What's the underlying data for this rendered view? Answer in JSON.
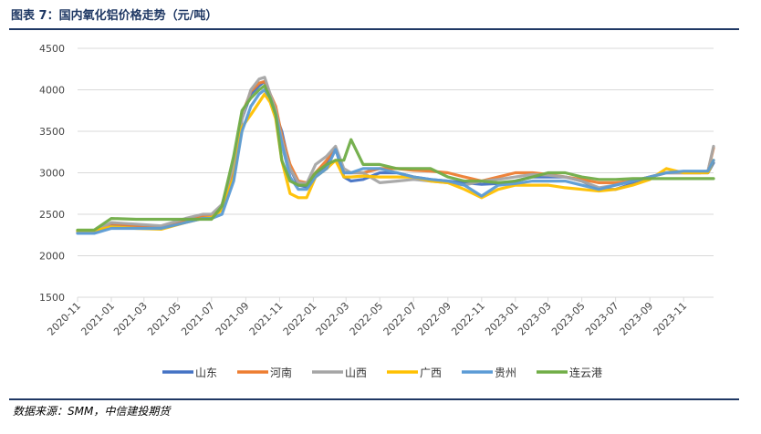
{
  "caption": "图表 7：国内氧化铝价格走势（元/吨）",
  "source": "数据来源：SMM，中信建投期货",
  "chart_data": {
    "type": "line",
    "title": "",
    "xlabel": "",
    "ylabel": "",
    "ylim": [
      1500,
      4500
    ],
    "yticks": [
      1500,
      2000,
      2500,
      3000,
      3500,
      4000,
      4500
    ],
    "xticks": [
      "2020-11",
      "2021-01",
      "2021-03",
      "2021-05",
      "2021-07",
      "2021-09",
      "2021-11",
      "2022-01",
      "2022-03",
      "2022-05",
      "2022-07",
      "2022-09",
      "2022-11",
      "2023-01",
      "2023-03",
      "2023-05",
      "2023-07",
      "2023-09",
      "2023-11"
    ],
    "xlim": [
      "2020-11-01",
      "2023-12-25"
    ],
    "grid": "horizontal",
    "legend_position": "bottom",
    "series": [
      {
        "name": "山东",
        "color": "#4472c4",
        "x": [
          "2020-11-01",
          "2020-12-01",
          "2021-01-01",
          "2021-02-15",
          "2021-04-01",
          "2021-05-15",
          "2021-06-15",
          "2021-07-01",
          "2021-07-20",
          "2021-08-10",
          "2021-08-25",
          "2021-09-10",
          "2021-09-25",
          "2021-10-05",
          "2021-10-15",
          "2021-10-25",
          "2021-11-05",
          "2021-11-20",
          "2021-12-05",
          "2021-12-20",
          "2022-01-05",
          "2022-01-25",
          "2022-02-10",
          "2022-02-25",
          "2022-03-10",
          "2022-04-01",
          "2022-05-01",
          "2022-06-01",
          "2022-07-01",
          "2022-08-01",
          "2022-09-01",
          "2022-10-01",
          "2022-11-01",
          "2022-12-01",
          "2023-01-01",
          "2023-02-01",
          "2023-03-01",
          "2023-04-01",
          "2023-05-01",
          "2023-06-01",
          "2023-07-01",
          "2023-08-01",
          "2023-09-01",
          "2023-10-01",
          "2023-11-01",
          "2023-12-01",
          "2023-12-15",
          "2023-12-25"
        ],
        "y": [
          2280,
          2280,
          2380,
          2360,
          2340,
          2420,
          2460,
          2470,
          2560,
          2980,
          3650,
          3950,
          4050,
          4100,
          3900,
          3700,
          3500,
          3050,
          2850,
          2830,
          2950,
          3100,
          3300,
          2950,
          2900,
          2920,
          3000,
          3000,
          2950,
          2920,
          2900,
          2880,
          2860,
          2870,
          2900,
          2950,
          2950,
          2950,
          2900,
          2800,
          2800,
          2870,
          2950,
          3000,
          3000,
          3000,
          3000,
          3120
        ]
      },
      {
        "name": "河南",
        "color": "#ed7d31",
        "x": [
          "2020-11-01",
          "2020-12-01",
          "2021-01-01",
          "2021-02-15",
          "2021-04-01",
          "2021-05-15",
          "2021-06-15",
          "2021-07-01",
          "2021-07-20",
          "2021-08-10",
          "2021-08-25",
          "2021-09-10",
          "2021-09-25",
          "2021-10-05",
          "2021-10-15",
          "2021-10-25",
          "2021-11-05",
          "2021-11-20",
          "2021-12-05",
          "2021-12-20",
          "2022-01-05",
          "2022-01-25",
          "2022-02-10",
          "2022-02-25",
          "2022-03-10",
          "2022-04-01",
          "2022-05-01",
          "2022-06-01",
          "2022-07-01",
          "2022-08-01",
          "2022-09-01",
          "2022-10-01",
          "2022-11-01",
          "2022-12-01",
          "2023-01-01",
          "2023-02-01",
          "2023-03-01",
          "2023-04-01",
          "2023-05-01",
          "2023-06-01",
          "2023-07-01",
          "2023-08-01",
          "2023-09-01",
          "2023-10-01",
          "2023-11-01",
          "2023-12-01",
          "2023-12-15",
          "2023-12-25"
        ],
        "y": [
          2300,
          2300,
          2390,
          2360,
          2330,
          2430,
          2480,
          2480,
          2580,
          3050,
          3700,
          3980,
          4080,
          4100,
          3950,
          3800,
          3450,
          3100,
          2900,
          2880,
          3000,
          3150,
          3300,
          3000,
          3000,
          3000,
          3050,
          3050,
          3030,
          3020,
          3000,
          2950,
          2900,
          2950,
          3000,
          3000,
          2980,
          2950,
          2920,
          2880,
          2880,
          2900,
          2950,
          3000,
          3000,
          3000,
          3020,
          3300
        ]
      },
      {
        "name": "山西",
        "color": "#a5a5a5",
        "x": [
          "2020-11-01",
          "2020-12-01",
          "2021-01-01",
          "2021-02-15",
          "2021-04-01",
          "2021-05-15",
          "2021-06-15",
          "2021-07-01",
          "2021-07-20",
          "2021-08-10",
          "2021-08-25",
          "2021-09-10",
          "2021-09-25",
          "2021-10-05",
          "2021-10-15",
          "2021-10-25",
          "2021-11-05",
          "2021-11-20",
          "2021-12-05",
          "2021-12-20",
          "2022-01-05",
          "2022-01-25",
          "2022-02-10",
          "2022-02-25",
          "2022-03-10",
          "2022-04-01",
          "2022-05-01",
          "2022-06-01",
          "2022-07-01",
          "2022-08-01",
          "2022-09-01",
          "2022-10-01",
          "2022-11-01",
          "2022-12-01",
          "2023-01-01",
          "2023-02-01",
          "2023-03-01",
          "2023-04-01",
          "2023-05-01",
          "2023-06-01",
          "2023-07-01",
          "2023-08-01",
          "2023-09-01",
          "2023-10-01",
          "2023-11-01",
          "2023-12-01",
          "2023-12-15",
          "2023-12-25"
        ],
        "y": [
          2290,
          2290,
          2400,
          2380,
          2360,
          2450,
          2500,
          2500,
          2620,
          3100,
          3650,
          4000,
          4130,
          4150,
          3950,
          3750,
          3400,
          3050,
          2880,
          2870,
          3100,
          3200,
          3320,
          3050,
          3000,
          3000,
          2880,
          2900,
          2920,
          2900,
          2880,
          2850,
          2900,
          2920,
          2950,
          2980,
          2970,
          2950,
          2900,
          2820,
          2850,
          2900,
          2950,
          3000,
          3000,
          3000,
          3020,
          3320
        ]
      },
      {
        "name": "广西",
        "color": "#ffc000",
        "x": [
          "2020-11-01",
          "2020-12-01",
          "2021-01-01",
          "2021-02-15",
          "2021-04-01",
          "2021-05-15",
          "2021-06-15",
          "2021-07-01",
          "2021-07-20",
          "2021-08-10",
          "2021-08-25",
          "2021-09-10",
          "2021-09-25",
          "2021-10-05",
          "2021-10-15",
          "2021-10-25",
          "2021-11-05",
          "2021-11-20",
          "2021-12-05",
          "2021-12-20",
          "2022-01-05",
          "2022-01-25",
          "2022-02-10",
          "2022-02-25",
          "2022-03-10",
          "2022-04-01",
          "2022-05-01",
          "2022-06-01",
          "2022-07-01",
          "2022-08-01",
          "2022-09-01",
          "2022-10-01",
          "2022-11-01",
          "2022-12-01",
          "2023-01-01",
          "2023-02-01",
          "2023-03-01",
          "2023-04-01",
          "2023-05-01",
          "2023-06-01",
          "2023-07-01",
          "2023-08-01",
          "2023-09-01",
          "2023-10-01",
          "2023-11-01",
          "2023-12-01",
          "2023-12-15",
          "2023-12-25"
        ],
        "y": [
          2300,
          2300,
          2350,
          2330,
          2320,
          2400,
          2450,
          2460,
          2550,
          2950,
          3550,
          3700,
          3850,
          3950,
          3850,
          3650,
          3150,
          2750,
          2700,
          2700,
          2950,
          3050,
          3150,
          2950,
          2950,
          2960,
          2950,
          2950,
          2950,
          2900,
          2880,
          2800,
          2700,
          2800,
          2850,
          2850,
          2850,
          2820,
          2800,
          2780,
          2800,
          2850,
          2920,
          3050,
          3000,
          3000,
          3000,
          3150
        ]
      },
      {
        "name": "贵州",
        "color": "#5b9bd5",
        "x": [
          "2020-11-01",
          "2020-12-01",
          "2021-01-01",
          "2021-02-15",
          "2021-04-01",
          "2021-05-15",
          "2021-06-15",
          "2021-07-01",
          "2021-07-20",
          "2021-08-10",
          "2021-08-25",
          "2021-09-10",
          "2021-09-25",
          "2021-10-05",
          "2021-10-15",
          "2021-10-25",
          "2021-11-05",
          "2021-11-20",
          "2021-12-05",
          "2021-12-20",
          "2022-01-05",
          "2022-01-25",
          "2022-02-10",
          "2022-02-25",
          "2022-03-10",
          "2022-04-01",
          "2022-05-01",
          "2022-06-01",
          "2022-07-01",
          "2022-08-01",
          "2022-09-01",
          "2022-10-01",
          "2022-11-01",
          "2022-12-01",
          "2023-01-01",
          "2023-02-01",
          "2023-03-01",
          "2023-04-01",
          "2023-05-01",
          "2023-06-01",
          "2023-07-01",
          "2023-08-01",
          "2023-09-01",
          "2023-10-01",
          "2023-11-01",
          "2023-12-01",
          "2023-12-15",
          "2023-12-25"
        ],
        "y": [
          2270,
          2270,
          2330,
          2330,
          2330,
          2400,
          2450,
          2450,
          2500,
          2900,
          3500,
          3800,
          3950,
          4000,
          3900,
          3700,
          3350,
          2950,
          2800,
          2800,
          2950,
          3050,
          3280,
          3000,
          3000,
          3050,
          3050,
          3000,
          2950,
          2920,
          2900,
          2850,
          2720,
          2850,
          2870,
          2900,
          2900,
          2900,
          2850,
          2800,
          2850,
          2900,
          2950,
          3000,
          3020,
          3020,
          3020,
          3150
        ]
      },
      {
        "name": "连云港",
        "color": "#70ad47",
        "x": [
          "2020-11-01",
          "2020-12-01",
          "2021-01-01",
          "2021-02-15",
          "2021-04-01",
          "2021-05-15",
          "2021-06-15",
          "2021-07-01",
          "2021-07-20",
          "2021-08-10",
          "2021-08-25",
          "2021-09-10",
          "2021-09-25",
          "2021-10-05",
          "2021-10-15",
          "2021-10-25",
          "2021-11-05",
          "2021-11-20",
          "2021-12-05",
          "2021-12-20",
          "2022-01-05",
          "2022-01-25",
          "2022-02-10",
          "2022-02-25",
          "2022-03-10",
          "2022-04-01",
          "2022-05-01",
          "2022-06-01",
          "2022-07-01",
          "2022-08-01",
          "2022-09-01",
          "2022-10-01",
          "2022-11-01",
          "2022-12-01",
          "2023-01-01",
          "2023-02-01",
          "2023-03-01",
          "2023-04-01",
          "2023-05-01",
          "2023-06-01",
          "2023-07-01",
          "2023-08-01",
          "2023-09-01",
          "2023-10-01",
          "2023-11-01",
          "2023-12-01",
          "2023-12-15",
          "2023-12-25"
        ],
        "y": [
          2310,
          2310,
          2450,
          2440,
          2440,
          2440,
          2440,
          2440,
          2600,
          3200,
          3750,
          3900,
          4000,
          4050,
          3900,
          3700,
          3150,
          2900,
          2850,
          2850,
          3000,
          3100,
          3150,
          3150,
          3400,
          3100,
          3100,
          3050,
          3050,
          3050,
          2950,
          2900,
          2900,
          2880,
          2900,
          2950,
          3000,
          3000,
          2950,
          2920,
          2920,
          2930,
          2930,
          2930,
          2930,
          2930,
          2930,
          2930
        ]
      }
    ]
  }
}
